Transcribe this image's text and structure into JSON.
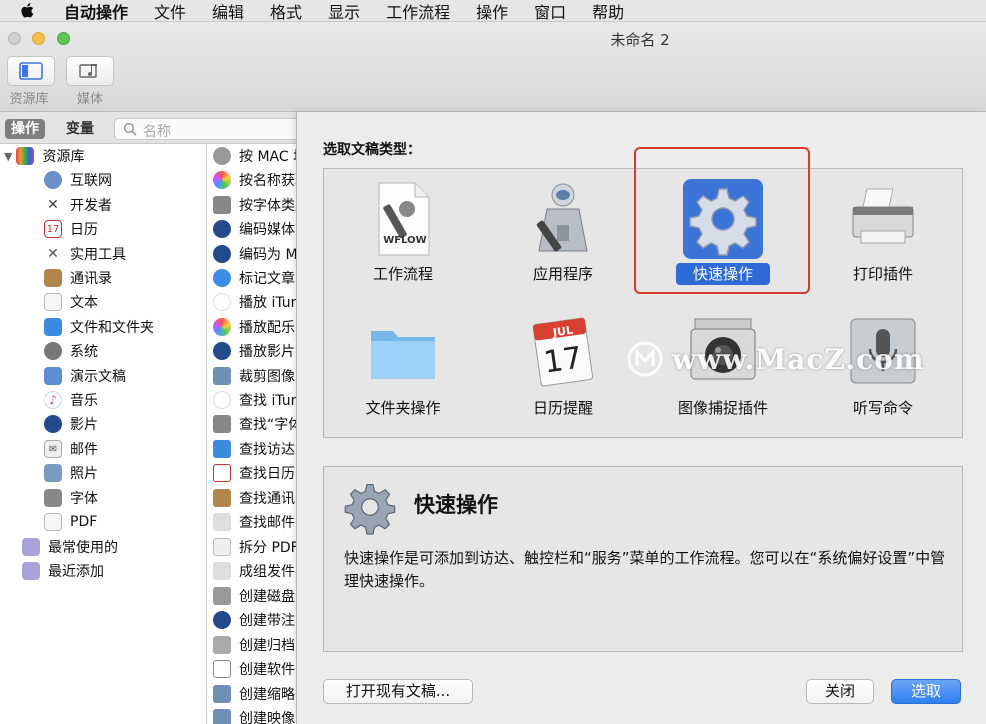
{
  "menubar": {
    "items": [
      "自动操作",
      "文件",
      "编辑",
      "格式",
      "显示",
      "工作流程",
      "操作",
      "窗口",
      "帮助"
    ]
  },
  "window": {
    "title": "未命名 2",
    "toolbar": {
      "library_label": "资源库",
      "media_label": "媒体"
    }
  },
  "tabs": {
    "actions": "操作",
    "variables": "变量",
    "search_placeholder": "名称"
  },
  "library": {
    "root": "资源库",
    "items": [
      "互联网",
      "开发者",
      "日历",
      "实用工具",
      "通讯录",
      "文本",
      "文件和文件夹",
      "系统",
      "演示文稿",
      "音乐",
      "影片",
      "邮件",
      "照片",
      "字体",
      "PDF"
    ],
    "recent": [
      "最常使用的",
      "最近添加"
    ]
  },
  "actions_list": [
    "按 MAC 地址",
    "按名称获取",
    "按字体类型",
    "编码媒体",
    "编码为 MPEG",
    "标记文章",
    "播放 iTunes",
    "播放配乐",
    "播放影片",
    "裁剪图像",
    "查找 iTunes",
    "查找“字体”",
    "查找访达",
    "查找日历",
    "查找通讯录",
    "查找邮件",
    "拆分 PDF",
    "成组发件",
    "创建磁盘",
    "创建带注",
    "创建归档",
    "创建软件",
    "创建缩略",
    "创建映像"
  ],
  "sheet": {
    "choose_label": "选取文稿类型：",
    "types": [
      {
        "label": "工作流程",
        "icon": "workflow-document-icon",
        "badge": "WFLOW"
      },
      {
        "label": "应用程序",
        "icon": "automator-robot-icon"
      },
      {
        "label": "快速操作",
        "icon": "gear-icon",
        "selected": true
      },
      {
        "label": "打印插件",
        "icon": "printer-icon"
      },
      {
        "label": "文件夹操作",
        "icon": "folder-icon"
      },
      {
        "label": "日历提醒",
        "icon": "calendar-icon",
        "month": "JUL",
        "day": "17"
      },
      {
        "label": "图像捕捉插件",
        "icon": "camera-icon"
      },
      {
        "label": "听写命令",
        "icon": "microphone-icon"
      }
    ],
    "description": {
      "title": "快速操作",
      "text": "快速操作是可添加到访达、触控栏和“服务”菜单的工作流程。您可以在“系统偏好设置”中管理快速操作。"
    },
    "buttons": {
      "open_existing": "打开现有文稿...",
      "close": "关闭",
      "choose": "选取"
    }
  },
  "watermark": "www.MacZ.com",
  "colors": {
    "selection": "#2f6bd6",
    "highlight_box": "#d63b2d",
    "primary_button": "#2f7ff0"
  }
}
